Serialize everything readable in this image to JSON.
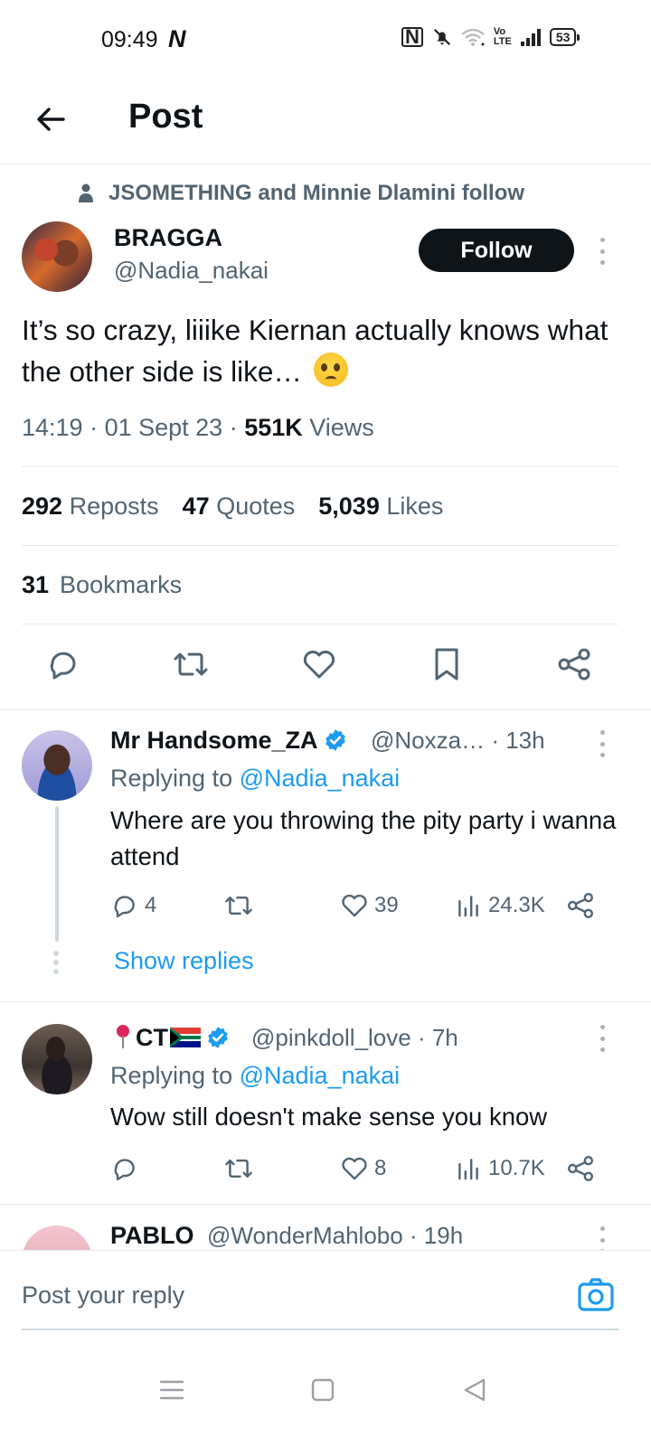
{
  "status_bar": {
    "time": "09:49",
    "n_badge": "N",
    "nfc": "N",
    "volte_top": "Vo",
    "volte_bottom": "LTE",
    "battery": "53"
  },
  "header": {
    "title": "Post"
  },
  "main_post": {
    "social_context": "JSOMETHING and Minnie Dlamini follow",
    "name": "BRAGGA",
    "handle": "@Nadia_nakai",
    "follow_label": "Follow",
    "text": "It’s so crazy, liiike Kiernan actually knows what the other side is like…",
    "time": "14:19",
    "date": "01 Sept 23",
    "views_count": "551K",
    "views_label": "Views",
    "reposts_count": "292",
    "reposts_label": "Reposts",
    "quotes_count": "47",
    "quotes_label": "Quotes",
    "likes_count": "5,039",
    "likes_label": "Likes",
    "bookmarks_count": "31",
    "bookmarks_label": "Bookmarks"
  },
  "replies": [
    {
      "name": "Mr Handsome_ZA",
      "handle_time": "@Noxza… · 13h",
      "replying_prefix": "Replying to ",
      "replying_to": "@Nadia_nakai",
      "text": "Where are you throwing the pity party i wanna attend",
      "reply_count": "4",
      "like_count": "39",
      "view_count": "24.3K",
      "show_replies": "Show replies"
    },
    {
      "name": "CT",
      "handle_time": "@pinkdoll_love · 7h",
      "replying_prefix": "Replying to ",
      "replying_to": "@Nadia_nakai",
      "text": "Wow still doesn't make sense you know",
      "like_count": "8",
      "view_count": "10.7K"
    },
    {
      "name": "PABLO",
      "handle_time": "@WonderMahlobo · 19h"
    }
  ],
  "composer": {
    "placeholder": "Post your reply"
  },
  "colors": {
    "accent": "#1d9bf0",
    "text": "#0f1419",
    "secondary": "#536471",
    "verified": "#1d9bf0"
  },
  "icons": [
    "back-arrow-icon",
    "person-icon",
    "more-icon",
    "reply-icon",
    "repost-icon",
    "like-icon",
    "bookmark-icon",
    "share-icon",
    "verified-icon",
    "views-icon",
    "camera-icon",
    "menu-icon",
    "home-icon",
    "back-icon"
  ]
}
